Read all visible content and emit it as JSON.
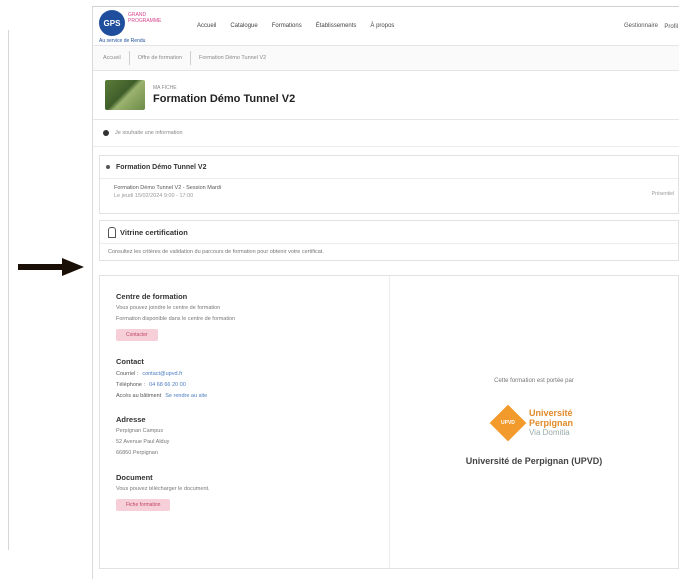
{
  "header": {
    "logo_abbr": "GPS",
    "logo_text": "GRAND PROGRAMME",
    "logo_sub": "Au service de Rendu",
    "nav": [
      "Accueil",
      "Catalogue",
      "Formations",
      "Établissements",
      "À propos"
    ],
    "user": "Gestionnaire",
    "user2": "Profil"
  },
  "breadcrumb": [
    "Accueil",
    "Offre de formation",
    "Formation Démo Tunnel V2"
  ],
  "title_block": {
    "label": "MA FICHE",
    "title": "Formation Démo Tunnel V2"
  },
  "session_line": "Je souhaite une information",
  "formation": {
    "head": "Formation Démo Tunnel V2",
    "line1": "Formation Démo Tunnel V2 - Session Mardi",
    "line2": "Le jeudi 15/02/2024 9:00 - 17:00",
    "right": "Présentiel"
  },
  "certification": {
    "head": "Vitrine certification",
    "text": "Consultez les critères de validation du parcours de formation pour obtenir votre certificat."
  },
  "contact": {
    "centre_title": "Centre de formation",
    "centre_p1": "Vous pouvez joindre le centre de formation",
    "centre_p2": "Formation disponible dans le centre de formation",
    "centre_btn": "Contacter",
    "contact_title": "Contact",
    "email_label": "Courriel :",
    "email_value": "contact@upvd.fr",
    "phone_label": "Téléphone :",
    "phone_value": "04 68 66 20 00",
    "access_label": "Accès au bâtiment",
    "access_value": "Se rendre au site",
    "addr_title": "Adresse",
    "addr1": "Perpignan Campus",
    "addr2": "52 Avenue Paul Alduy",
    "addr3": "66860 Perpignan",
    "doc_title": "Document",
    "doc_p": "Vous pouvez télécharger le document.",
    "doc_btn": "Fiche formation",
    "right_text": "Cette formation est portée par",
    "upvd_abbr": "UPVD",
    "upvd_l1": "Université",
    "upvd_l2": "Perpignan",
    "upvd_l3": "Via Domitia",
    "uname": "Université de Perpignan (UPVD)"
  },
  "colors": {
    "brand_blue": "#1f4f9c",
    "pill_pink": "#f6cfd8",
    "upvd_orange": "#f39a2d"
  }
}
